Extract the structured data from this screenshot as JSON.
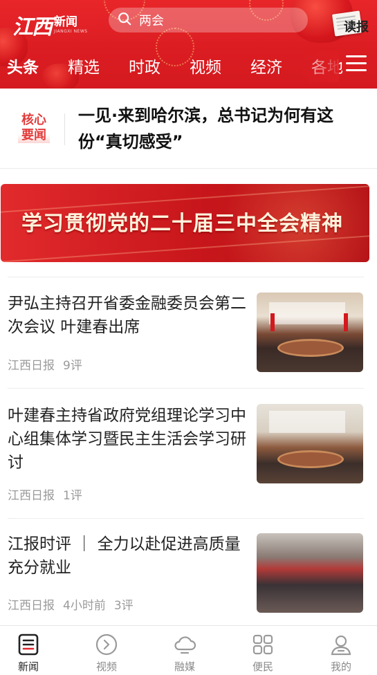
{
  "header": {
    "logo": {
      "brush": "江西",
      "title": "新闻",
      "sub": "JIANGXI NEWS"
    },
    "search": {
      "placeholder": "两会"
    },
    "dubao_label": "读报",
    "tabs": [
      {
        "label": "头条",
        "active": true
      },
      {
        "label": "精选",
        "active": false
      },
      {
        "label": "时政",
        "active": false
      },
      {
        "label": "视频",
        "active": false
      },
      {
        "label": "经济",
        "active": false
      },
      {
        "label": "各地",
        "active": false
      }
    ],
    "menu_icon": "hamburger-icon"
  },
  "headline": {
    "badge_line1": "核心",
    "badge_line2": "要闻",
    "title": "一见·来到哈尔滨，总书记为何有这份“真切感受”"
  },
  "banner": {
    "title": "学习贯彻党的二十届三中全会精神"
  },
  "news": [
    {
      "title": "尹弘主持召开省委金融委员会第二次会议 叶建春出席",
      "source": "江西日报",
      "time": "",
      "comments": "9评"
    },
    {
      "title": "叶建春主持省政府党组理论学习中心组集体学习暨民主生活会学习研讨",
      "source": "江西日报",
      "time": "",
      "comments": "1评"
    },
    {
      "title": "江报时评 ｜ 全力以赴促进高质量充分就业",
      "source": "江西日报",
      "time": "4小时前",
      "comments": "3评"
    }
  ],
  "bottom_nav": [
    {
      "label": "新闻",
      "icon": "news-icon",
      "active": true
    },
    {
      "label": "视频",
      "icon": "video-play-icon",
      "active": false
    },
    {
      "label": "融媒",
      "icon": "cloud-icon",
      "active": false
    },
    {
      "label": "便民",
      "icon": "grid-apps-icon",
      "active": false
    },
    {
      "label": "我的",
      "icon": "user-icon",
      "active": false
    }
  ],
  "colors": {
    "brand_red": "#e0252a",
    "badge_red": "#e23b3b",
    "meta_gray": "#9a9a9a"
  }
}
